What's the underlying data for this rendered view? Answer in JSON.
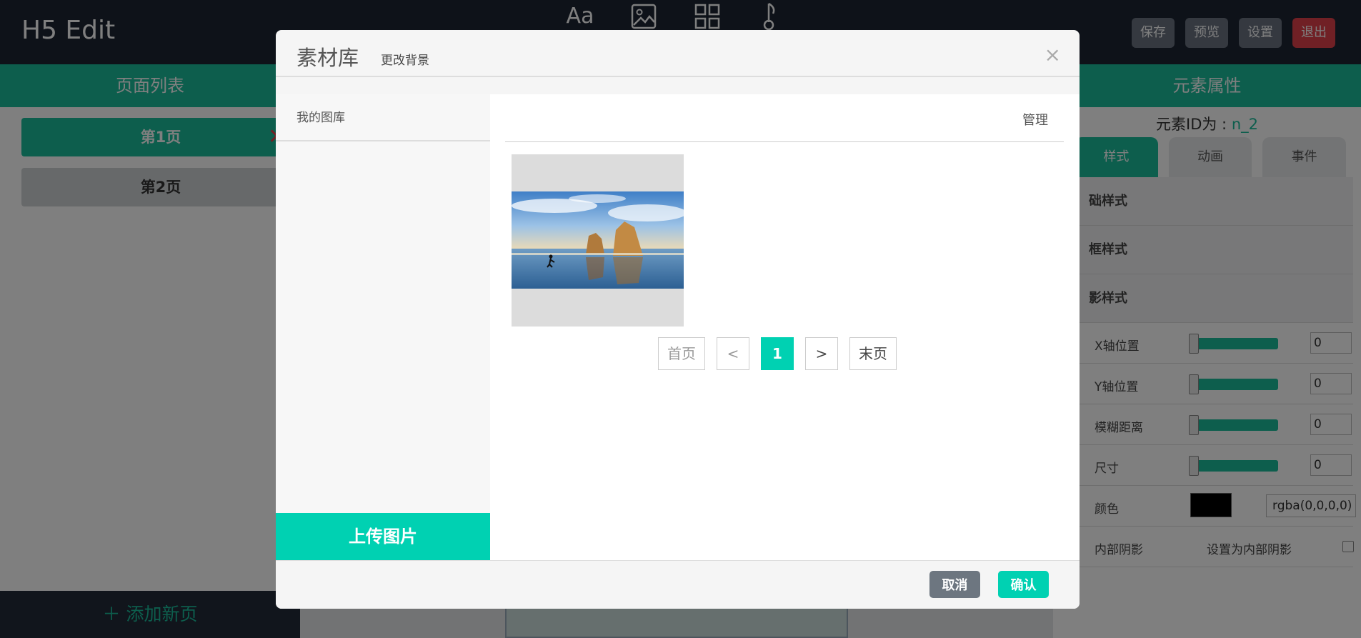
{
  "app": {
    "title": "H5 Edit",
    "actions": [
      "保存",
      "预览",
      "设置",
      "退出"
    ],
    "tool_icons": [
      "text-icon",
      "image-icon",
      "grid-icon",
      "music-icon"
    ],
    "tool_text_glyph": "Aa"
  },
  "left": {
    "header": "页面列表",
    "pages": [
      "第1页",
      "第2页"
    ],
    "delete_glyph": "✕",
    "add_page": "＋ 添加新页"
  },
  "right": {
    "header": "元素属性",
    "elem_id_label": "元素ID为 : ",
    "elem_id_value": "n_2",
    "tabs": [
      "样式",
      "动画",
      "事件"
    ],
    "sections": [
      "础样式",
      "框样式",
      "影样式"
    ],
    "rows": [
      {
        "label": "X轴位置",
        "value": "0"
      },
      {
        "label": "Y轴位置",
        "value": "0"
      },
      {
        "label": "模糊距离",
        "value": "0"
      },
      {
        "label": "尺寸",
        "value": "0"
      }
    ],
    "color_label": "颜色",
    "color_value": "rgba(0,0,0,0)",
    "inner_label": "内部阴影",
    "inner_option": "设置为内部阴影"
  },
  "modal": {
    "title": "素材库",
    "subtitle": "更改背景",
    "close_glyph": "×",
    "side_item": "我的图库",
    "upload": "上传图片",
    "manage": "管理",
    "pager": {
      "first": "首页",
      "prev": "<",
      "current": "1",
      "next": ">",
      "last": "末页"
    },
    "cancel": "取消",
    "confirm": "确认"
  },
  "colors": {
    "accent": "#1bbc9b",
    "modal_accent": "#00d1b2",
    "topbar": "#1d2433",
    "danger": "#e0414a"
  }
}
